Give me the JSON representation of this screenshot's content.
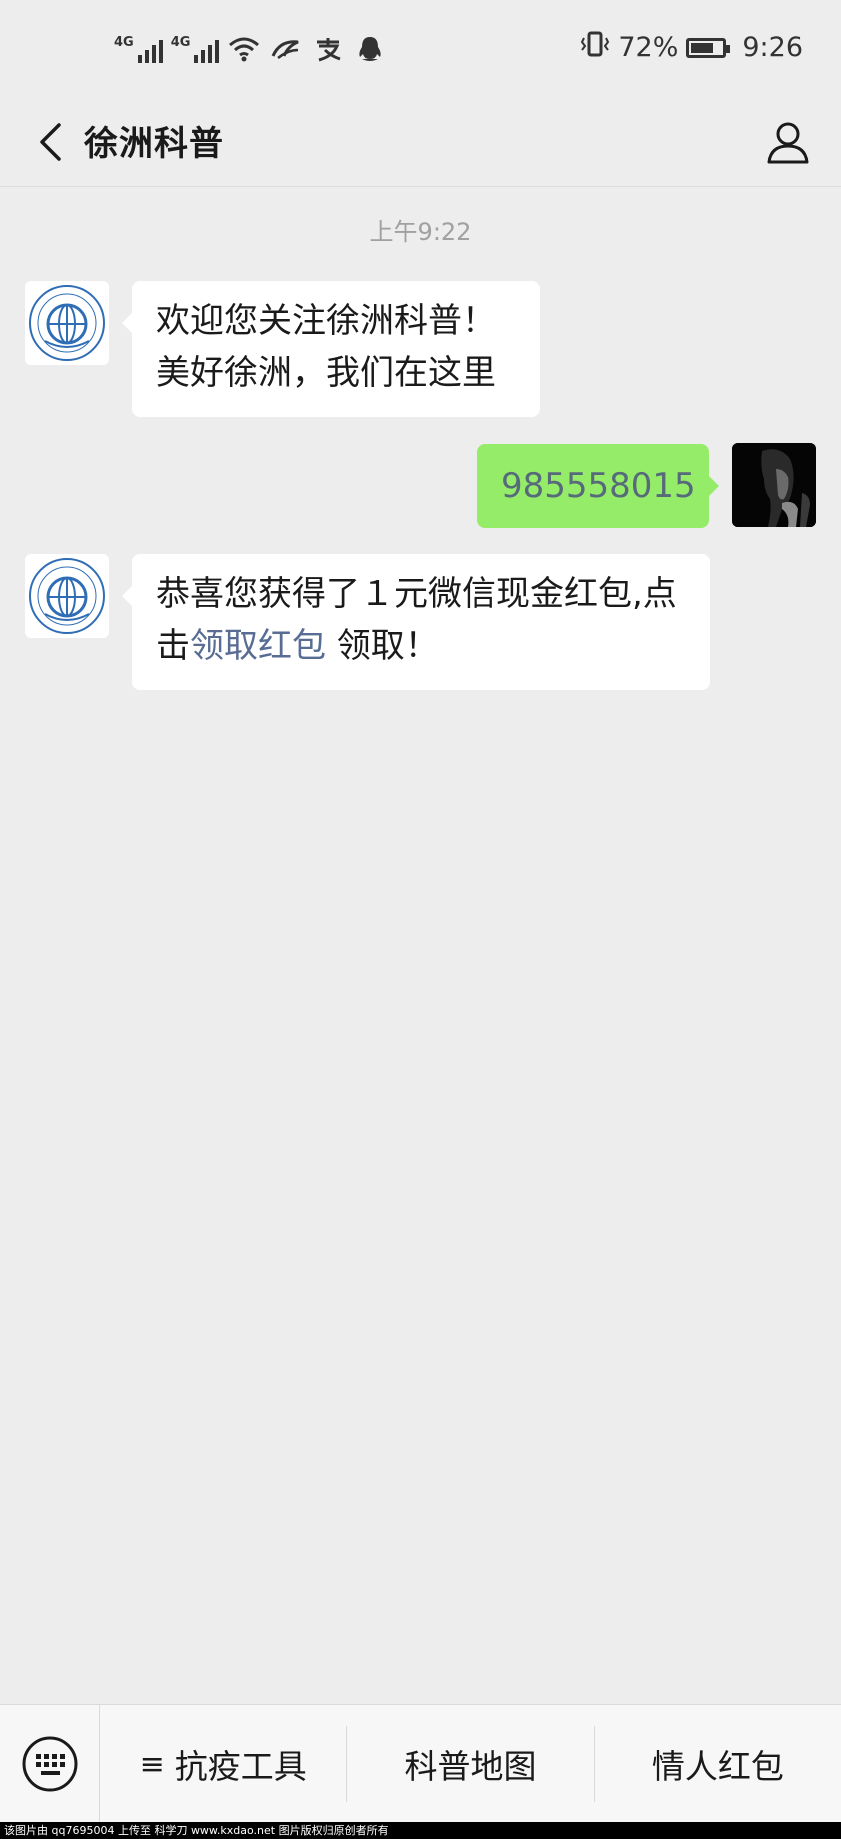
{
  "status_bar": {
    "network1": "4G",
    "network2": "4G",
    "battery_text": "72%",
    "battery_level": 0.72,
    "time": "9:26",
    "icons": [
      "signal-icon",
      "signal-icon",
      "wifi-icon",
      "alipay-bird-icon",
      "alipay-icon",
      "qq-icon",
      "vibrate-icon",
      "battery-icon"
    ]
  },
  "header": {
    "title": "徐洲科普",
    "back_icon": "chevron-left-icon",
    "profile_icon": "person-icon"
  },
  "chat": {
    "timestamp": "上午9:22",
    "messages": [
      {
        "from": "official",
        "lines": [
          "欢迎您关注徐洲科普！",
          "美好徐洲，我们在这里"
        ]
      },
      {
        "from": "me",
        "text": "985558015"
      },
      {
        "from": "official",
        "line1": "恭喜您获得了１元微信现金红包,点",
        "line2_prefix": "击",
        "link": "领取红包",
        "line2_suffix": " 领取！"
      }
    ]
  },
  "menu": {
    "keyboard_icon": "keyboard-icon",
    "items": [
      {
        "icon": "≡",
        "label": "抗疫工具"
      },
      {
        "label": "科普地图"
      },
      {
        "label": "情人红包"
      }
    ]
  },
  "watermark": "该图片由 qq7695004 上传至 科学刀 www.kxdao.net 图片版权归原创者所有",
  "colors": {
    "background": "#ededed",
    "bubble_self": "#95ec69",
    "link": "#586c94"
  }
}
